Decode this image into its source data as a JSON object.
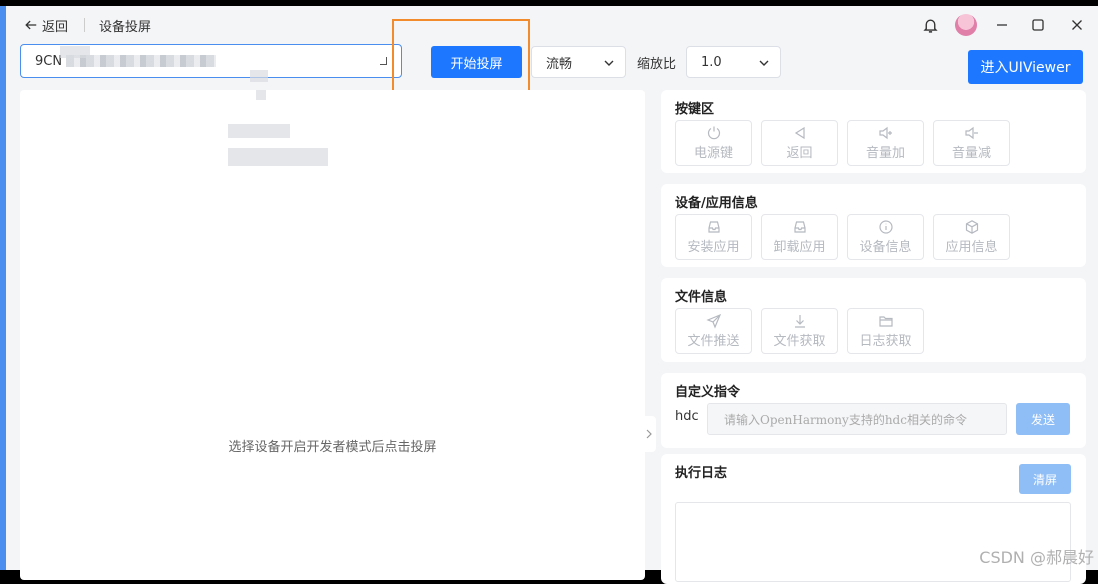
{
  "titlebar": {
    "back_label": "返回",
    "page_title": "设备投屏"
  },
  "toolbar": {
    "device_value": "9CN",
    "start_label": "开始投屏",
    "quality_value": "流畅",
    "zoom_label": "缩放比",
    "zoom_value": "1.0",
    "uiviewer_label": "进入UIViewer"
  },
  "screen": {
    "hint": "选择设备开启开发者模式后点击投屏"
  },
  "keys_panel": {
    "title": "按键区",
    "buttons": [
      {
        "label": "电源键",
        "icon": "power-icon"
      },
      {
        "label": "返回",
        "icon": "back-triangle-icon"
      },
      {
        "label": "音量加",
        "icon": "volume-up-icon"
      },
      {
        "label": "音量减",
        "icon": "volume-down-icon"
      }
    ]
  },
  "info_panel": {
    "title": "设备/应用信息",
    "buttons": [
      {
        "label": "安装应用",
        "icon": "install-icon"
      },
      {
        "label": "卸载应用",
        "icon": "uninstall-icon"
      },
      {
        "label": "设备信息",
        "icon": "info-icon"
      },
      {
        "label": "应用信息",
        "icon": "package-icon"
      }
    ]
  },
  "file_panel": {
    "title": "文件信息",
    "buttons": [
      {
        "label": "文件推送",
        "icon": "send-icon"
      },
      {
        "label": "文件获取",
        "icon": "download-icon"
      },
      {
        "label": "日志获取",
        "icon": "folder-icon"
      }
    ]
  },
  "cmd_panel": {
    "title": "自定义指令",
    "hdc_label": "hdc",
    "placeholder": "请输入OpenHarmony支持的hdc相关的命令",
    "send_label": "发送"
  },
  "log_panel": {
    "title": "执行日志",
    "clear_label": "清屏"
  },
  "watermark": "CSDN @郝晨好",
  "colors": {
    "primary": "#1e78ff",
    "primary_disabled": "#8fbdf6",
    "highlight": "#f28b2c",
    "background": "#f4f5f7"
  }
}
